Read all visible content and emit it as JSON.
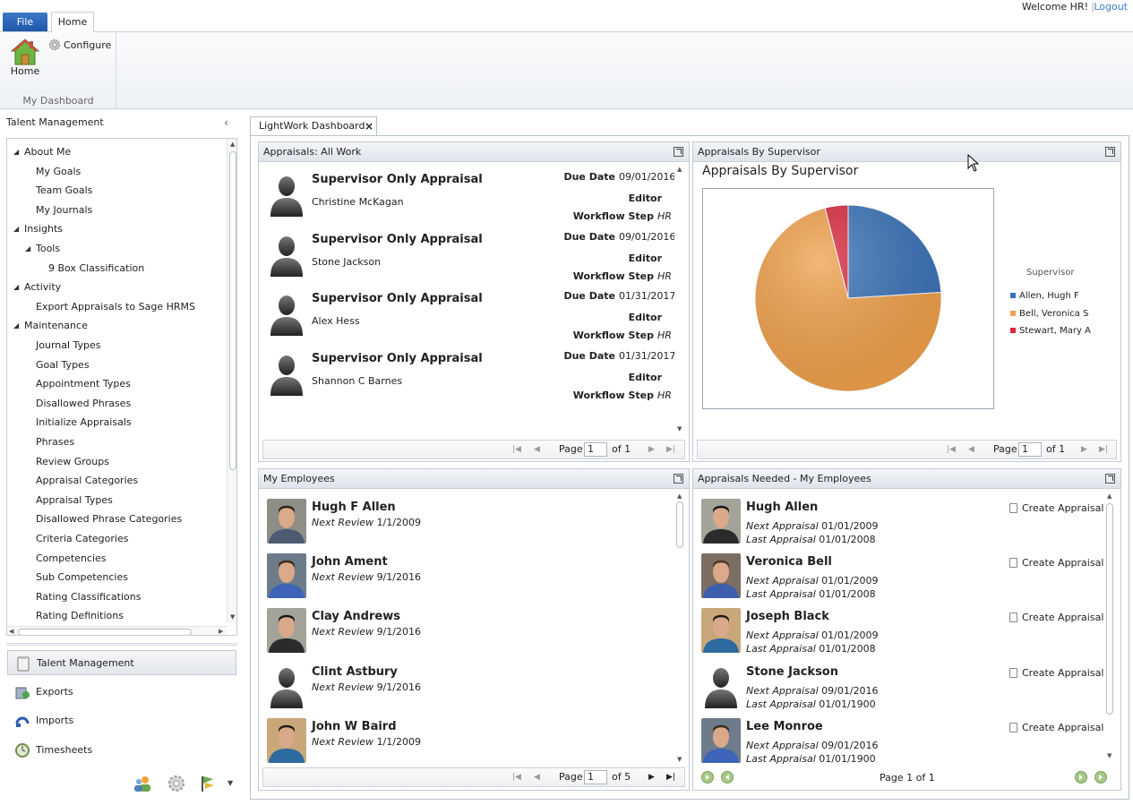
{
  "topbar": {
    "file_tab": "File",
    "home_tab": "Home",
    "welcome": "Welcome HR!",
    "separator": "|",
    "logout": "Logout"
  },
  "ribbon": {
    "home_label": "Home",
    "configure_label": "Configure",
    "group_label": "My Dashboard"
  },
  "sidebar": {
    "header": "Talent Management",
    "collapse_glyph": "‹",
    "tree": [
      {
        "label": "About Me",
        "level": 0,
        "expandable": true
      },
      {
        "label": "My Goals",
        "level": 1
      },
      {
        "label": "Team Goals",
        "level": 1
      },
      {
        "label": "My Journals",
        "level": 1
      },
      {
        "label": "Insights",
        "level": 0,
        "expandable": true
      },
      {
        "label": "Tools",
        "level": 1,
        "expandable": true
      },
      {
        "label": "9 Box Classification",
        "level": 2
      },
      {
        "label": "Activity",
        "level": 0,
        "expandable": true
      },
      {
        "label": "Export Appraisals to Sage HRMS",
        "level": 1
      },
      {
        "label": "Maintenance",
        "level": 0,
        "expandable": true
      },
      {
        "label": "Journal Types",
        "level": 1
      },
      {
        "label": "Goal Types",
        "level": 1
      },
      {
        "label": "Appointment Types",
        "level": 1
      },
      {
        "label": "Disallowed Phrases",
        "level": 1
      },
      {
        "label": "Initialize Appraisals",
        "level": 1
      },
      {
        "label": "Phrases",
        "level": 1
      },
      {
        "label": "Review Groups",
        "level": 1
      },
      {
        "label": "Appraisal Categories",
        "level": 1
      },
      {
        "label": "Appraisal Types",
        "level": 1
      },
      {
        "label": "Disallowed Phrase Categories",
        "level": 1
      },
      {
        "label": "Criteria Categories",
        "level": 1
      },
      {
        "label": "Competencies",
        "level": 1
      },
      {
        "label": "Sub Competencies",
        "level": 1
      },
      {
        "label": "Rating Classifications",
        "level": 1
      },
      {
        "label": "Rating Definitions",
        "level": 1
      }
    ],
    "nav": [
      {
        "label": "Talent Management",
        "icon": "clipboard-icon",
        "active": true
      },
      {
        "label": "Exports",
        "icon": "export-icon",
        "active": false
      },
      {
        "label": "Imports",
        "icon": "import-icon",
        "active": false
      },
      {
        "label": "Timesheets",
        "icon": "timesheet-icon",
        "active": false
      }
    ]
  },
  "doc_tab": {
    "label": "LightWork Dashboard",
    "close": "×"
  },
  "panels": {
    "all_work": {
      "title": "Appraisals: All Work",
      "labels": {
        "due": "Due Date",
        "editor": "Editor",
        "step": "Workflow Step"
      },
      "items": [
        {
          "title": "Supervisor Only Appraisal",
          "employee": "Christine  McKagan",
          "due": "09/01/2016",
          "step": "HR"
        },
        {
          "title": "Supervisor Only Appraisal",
          "employee": "Stone  Jackson",
          "due": "09/01/2016",
          "step": "HR"
        },
        {
          "title": "Supervisor Only Appraisal",
          "employee": "Alex  Hess",
          "due": "01/31/2017",
          "step": "HR"
        },
        {
          "title": "Supervisor Only Appraisal",
          "employee": "Shannon C Barnes",
          "due": "01/31/2017",
          "step": "HR"
        }
      ],
      "pager": {
        "page_label": "Page",
        "page": "1",
        "of": "of 1"
      }
    },
    "by_supervisor": {
      "title": "Appraisals By Supervisor",
      "pager": {
        "page_label": "Page",
        "page": "1",
        "of": "of 1"
      }
    },
    "my_employees": {
      "title": "My Employees",
      "review_label": "Next Review",
      "items": [
        {
          "name": "Hugh F Allen",
          "review": "1/1/2009",
          "photo": "photo"
        },
        {
          "name": "John Ament",
          "review": "9/1/2016",
          "photo": "photo"
        },
        {
          "name": "Clay Andrews",
          "review": "9/1/2016",
          "photo": "photo"
        },
        {
          "name": "Clint Astbury",
          "review": "9/1/2016",
          "photo": "silhouette"
        },
        {
          "name": "John W Baird",
          "review": "1/1/2009",
          "photo": "photo"
        }
      ],
      "pager": {
        "page_label": "Page",
        "page": "1",
        "of": "of 5"
      }
    },
    "needed": {
      "title": "Appraisals Needed - My Employees",
      "next_label": "Next Appraisal",
      "last_label": "Last Appraisal",
      "create_label": "Create Appraisal",
      "items": [
        {
          "name": "Hugh Allen",
          "next": "01/01/2009",
          "last": "01/01/2008",
          "photo": "photo"
        },
        {
          "name": "Veronica Bell",
          "next": "01/01/2009",
          "last": "01/01/2008",
          "photo": "photo"
        },
        {
          "name": "Joseph Black",
          "next": "01/01/2009",
          "last": "01/01/2008",
          "photo": "photo"
        },
        {
          "name": "Stone Jackson",
          "next": "09/01/2016",
          "last": "01/01/1900",
          "photo": "silhouette"
        },
        {
          "name": "Lee Monroe",
          "next": "09/01/2016",
          "last": "01/01/1900",
          "photo": "photo"
        }
      ],
      "pager_text": "Page 1 of 1"
    }
  },
  "chart_data": {
    "type": "pie",
    "title": "Appraisals By Supervisor",
    "legend_title": "Supervisor",
    "legend_position": "right",
    "slices": [
      {
        "name": "Allen, Hugh F",
        "value": 24,
        "color": "#3a72b8"
      },
      {
        "name": "Bell, Veronica S",
        "value": 72,
        "color": "#f0a04a"
      },
      {
        "name": "Stewart, Mary A",
        "value": 4,
        "color": "#d8283c"
      }
    ]
  }
}
